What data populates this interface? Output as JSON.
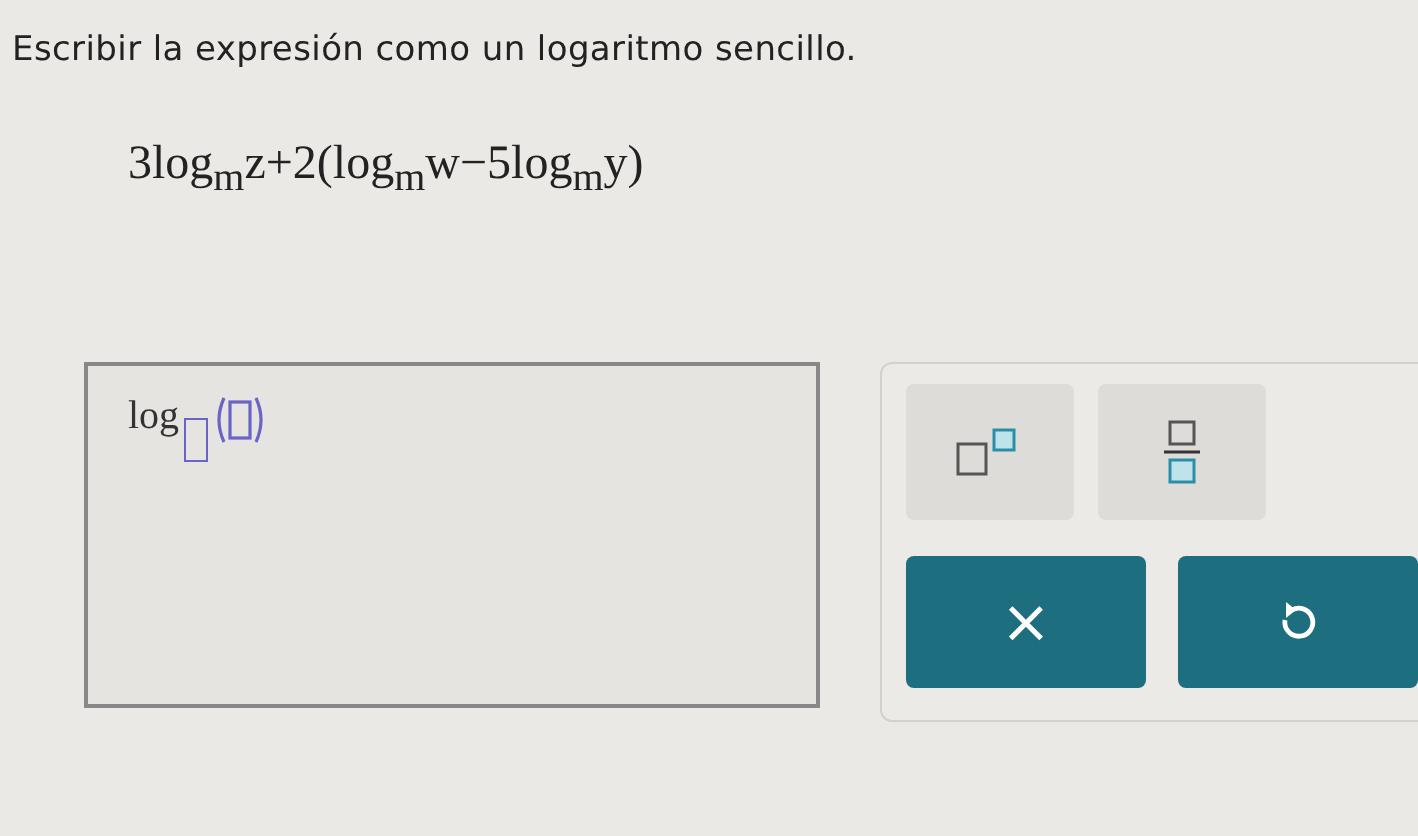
{
  "instruction": "Escribir la expresión como un logaritmo sencillo.",
  "expression": "3log$_{m}$z+2(log$_{m}$w−5log$_{m}$y)",
  "answer": {
    "function_label": "log"
  },
  "keypad": {
    "templates": [
      {
        "kind": "superscript"
      },
      {
        "kind": "fraction"
      }
    ],
    "actions": [
      {
        "kind": "clear",
        "label": "×"
      },
      {
        "kind": "undo"
      }
    ]
  }
}
